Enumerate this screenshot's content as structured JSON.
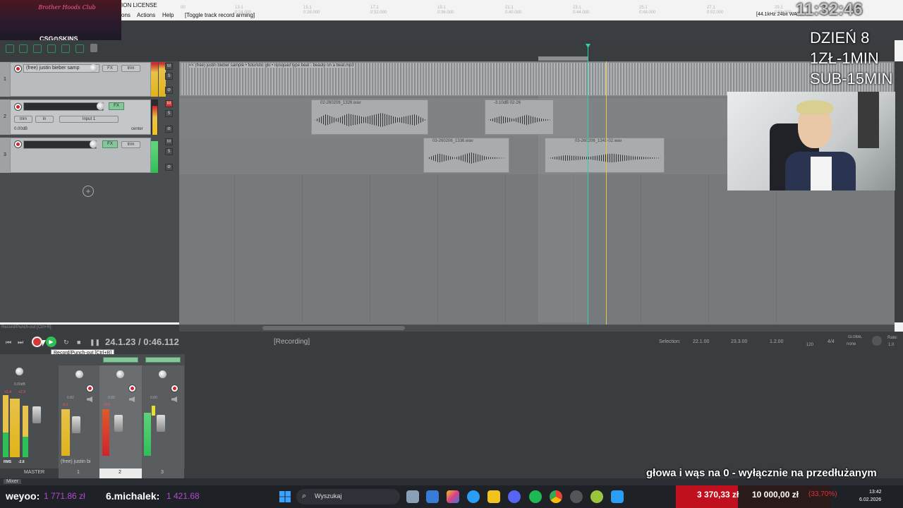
{
  "menu": {
    "title": "ION LICENSE",
    "items": [
      "ons",
      "Actions",
      "Help",
      "[Toggle track record arming]"
    ],
    "info": "[44.1kHz 24bit WA"
  },
  "overlay": {
    "club": "Brother Hoods Club",
    "sponsor": "CSG⊙SKINS",
    "clock": "11:32:46",
    "day": "DZIEŃ 8",
    "rate": "1ZŁ-1MIN",
    "sub": "SUB-15MIN",
    "ticker": "głowa i wąs na 0 - wyłącznie na przedłużanym"
  },
  "ruler": {
    "labels": [
      "00",
      "13.1",
      "15.1",
      "17.1",
      "19.1",
      "21.1",
      "23.1",
      "25.1",
      "27.1",
      "29.1"
    ],
    "times": [
      "",
      "0:24.000",
      "0:28.000",
      "0:32.000",
      "0:36.000",
      "0:40.000",
      "0:44.000",
      "0:48.000",
      "0:52.000",
      "0:56.000"
    ]
  },
  "tracks": [
    {
      "num": "1",
      "name": "(free) justin bieber samp",
      "fx": "FX",
      "trim": "trim"
    },
    {
      "num": "2",
      "name": "",
      "input": "Input 1",
      "vol": "0.00dB",
      "pan": "center",
      "fx": "FX",
      "trim": "trim",
      "in": "in"
    },
    {
      "num": "3",
      "name": "",
      "fx": "FX",
      "trim": "trim"
    }
  ],
  "items": [
    {
      "label": "<< (free) justin bieber sample • futuristic glo • ripsquad type beat - beauty on a beat.mp3"
    },
    {
      "label": "02-260206_1326.wav"
    },
    {
      "label": "-3.10dB 02-26"
    },
    {
      "label": "03-260206_1336.wav"
    },
    {
      "label": "03-260206_1341-02.wav"
    }
  ],
  "transport": {
    "position": "24.1.23 / 0:46.112",
    "status": "[Recording]",
    "tooltip": "Record/Punch-out [Ctrl+R]",
    "topnote": "Record/Punch-out [Ctrl+R]",
    "selection_label": "Selection:",
    "sel_start": "22.1.00",
    "sel_end": "23.3.00",
    "sel_len": "1.2.00",
    "bpm": "120",
    "sig": "4/4",
    "global": "GLOBAL",
    "none": "none",
    "rate": "Rate:",
    "rate_val": "1.0"
  },
  "mixer": {
    "master": "MASTER",
    "strip1": "(free) justin bi",
    "nums": [
      "1",
      "2",
      "3"
    ],
    "rms": "RMS",
    "rmsval": "-2.6",
    "tab": "Mixer",
    "vals": [
      "+2.4",
      "+2.9",
      "0.00dB",
      "-0.1",
      "0.82",
      "+0.0",
      "0.00",
      "0.00"
    ]
  },
  "taskbar": {
    "user1": "weyoo:",
    "amt1": "1 771.86 zł",
    "user2": "6.michalek:",
    "amt2": "1 421.68",
    "search": "Wyszukaj",
    "goal_now": "3 370,33 zł",
    "goal_total": "10 000,00 zł",
    "goal_pct": "(33,70%)",
    "time": "13:42",
    "date": "6.02.2026"
  }
}
